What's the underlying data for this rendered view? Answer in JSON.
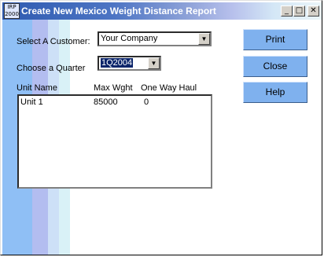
{
  "window": {
    "title": "Create New Mexico Weight Distance Report",
    "icon_text": "IRP 2000",
    "controls": {
      "minimize": "_",
      "maximize": "□",
      "close": "✕"
    }
  },
  "form": {
    "customer_label": "Select A Customer:",
    "customer_value": "Your Company",
    "quarter_label": "Choose a Quarter",
    "quarter_value": "1Q2004"
  },
  "buttons": {
    "print": "Print",
    "close": "Close",
    "help": "Help"
  },
  "table": {
    "headers": [
      "Unit Name",
      "Max Wght",
      "One Way Haul"
    ],
    "rows": [
      {
        "unit": "Unit 1",
        "max_wght": "85000",
        "one_way_haul": "0"
      }
    ]
  },
  "colors": {
    "button_face": "#7fb1ee",
    "title_start": "#2f5bb0"
  }
}
